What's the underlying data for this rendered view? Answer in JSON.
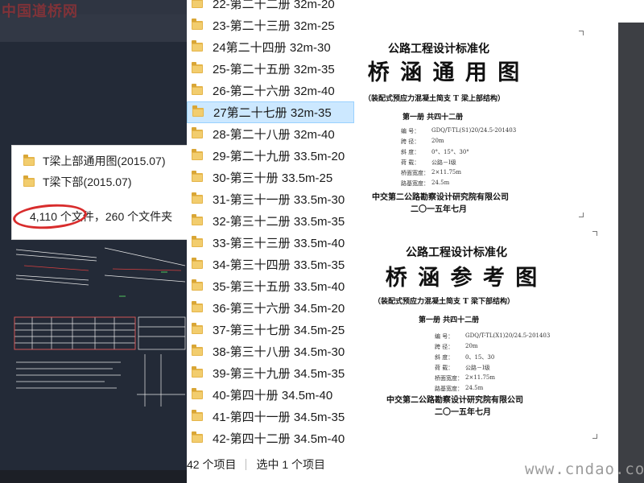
{
  "watermark_top": "中国道桥网",
  "watermark_bottom": "www.cndao.com",
  "popup": {
    "items": [
      {
        "label": "T梁上部通用图(2015.07)"
      },
      {
        "label": "T梁下部(2015.07)"
      }
    ],
    "status": "4,110 个文件，260 个文件夹"
  },
  "file_list": {
    "items": [
      {
        "label": "22-第二十二册 32m-20"
      },
      {
        "label": "23-第二十三册 32m-25"
      },
      {
        "label": "24第二十四册 32m-30"
      },
      {
        "label": "25-第二十五册 32m-35"
      },
      {
        "label": "26-第二十六册 32m-40"
      },
      {
        "label": "27第二十七册 32m-35",
        "selected": true
      },
      {
        "label": "28-第二十八册 32m-40"
      },
      {
        "label": "29-第二十九册 33.5m-20"
      },
      {
        "label": "30-第三十册 33.5m-25"
      },
      {
        "label": "31-第三十一册 33.5m-30"
      },
      {
        "label": "32-第三十二册 33.5m-35"
      },
      {
        "label": "33-第三十三册 33.5m-40"
      },
      {
        "label": "34-第三十四册 33.5m-35"
      },
      {
        "label": "35-第三十五册 33.5m-40"
      },
      {
        "label": "36-第三十六册 34.5m-20"
      },
      {
        "label": "37-第三十七册 34.5m-25"
      },
      {
        "label": "38-第三十八册 34.5m-30"
      },
      {
        "label": "39-第三十九册 34.5m-35"
      },
      {
        "label": "40-第四十册 34.5m-40"
      },
      {
        "label": "41-第四十一册 34.5m-35"
      },
      {
        "label": "42-第四十二册 34.5m-40"
      }
    ],
    "status_count": "42 个项目",
    "status_selected": "选中 1 个项目"
  },
  "doc1": {
    "series": "公路工程设计标准化",
    "title": "桥 涵 通 用 图",
    "subtitle": "（装配式预应力混凝土简支 T 梁上部结构）",
    "volume": "第一册   共四十二册",
    "specs": [
      {
        "k": "编    号：",
        "v": "GDQ/T-TL(S1)20/24.5-201403"
      },
      {
        "k": "跨    径：",
        "v": "20m"
      },
      {
        "k": "斜    度：",
        "v": "0°、15°、30°"
      },
      {
        "k": "荷    载：",
        "v": "公路－I级"
      },
      {
        "k": "桥面宽度：",
        "v": "2×11.75m"
      },
      {
        "k": "路基宽度：",
        "v": "24.5m"
      }
    ],
    "org": "中交第二公路勘察设计研究院有限公司",
    "date": "二〇一五年七月"
  },
  "doc2": {
    "series": "公路工程设计标准化",
    "title": "桥 涵 参 考 图",
    "subtitle": "（装配式预应力混凝土简支 T 梁下部结构）",
    "volume": "第一册   共四十二册",
    "specs": [
      {
        "k": "编    号：",
        "v": "GDQ/T-TL(X1)20/24.5-201403"
      },
      {
        "k": "跨    径：",
        "v": "20m"
      },
      {
        "k": "斜    度：",
        "v": "0、15、30"
      },
      {
        "k": "荷    载：",
        "v": "公路－I级"
      },
      {
        "k": "桥面宽度：",
        "v": "2×11.75m"
      },
      {
        "k": "路基宽度：",
        "v": "24.5m"
      }
    ],
    "org": "中交第二公路勘察设计研究院有限公司",
    "date": "二〇一五年七月"
  }
}
